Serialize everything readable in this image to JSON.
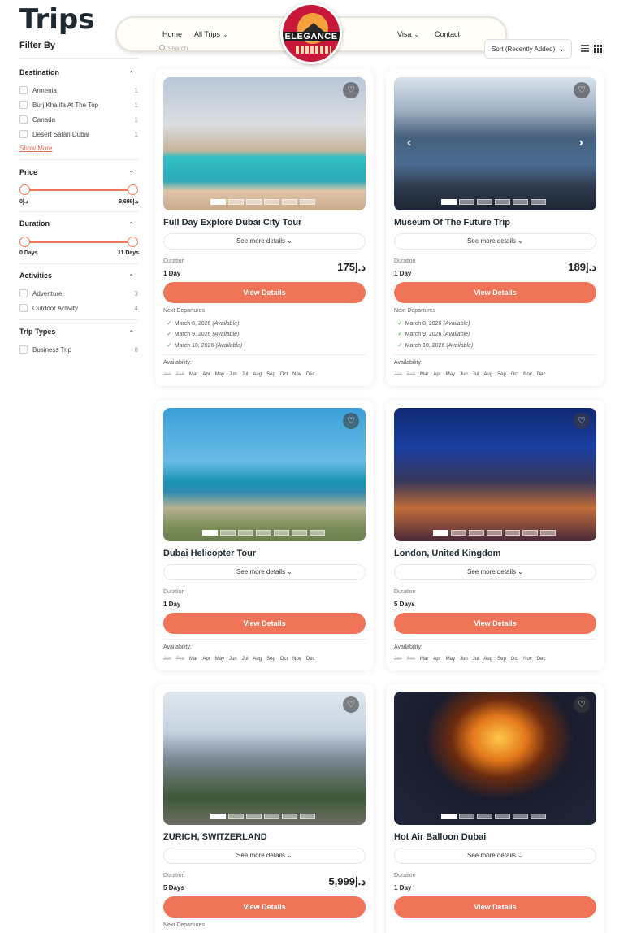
{
  "page": {
    "title": "Trips"
  },
  "nav": {
    "home": "Home",
    "all_trips": "All Trips",
    "visa": "Visa",
    "contact": "Contact",
    "logo_text": "ELEGANCE"
  },
  "search": {
    "placeholder": "Search"
  },
  "sort": {
    "label": "Sort (Recently Added)"
  },
  "sidebar": {
    "filter_by": "Filter By",
    "destination": {
      "title": "Destination",
      "options": [
        {
          "label": "Armenia",
          "count": "1"
        },
        {
          "label": "Burj Khalifa At The Top",
          "count": "1"
        },
        {
          "label": "Canada",
          "count": "1"
        },
        {
          "label": "Desert Safari Dubai",
          "count": "1"
        }
      ],
      "show_more": "Show More"
    },
    "price": {
      "title": "Price",
      "min": "0د.إ",
      "max": "9,699د.إ"
    },
    "duration": {
      "title": "Duration",
      "min": "0 Days",
      "max": "11 Days"
    },
    "activities": {
      "title": "Activities",
      "options": [
        {
          "label": "Adventure",
          "count": "3"
        },
        {
          "label": "Outdoor Activity",
          "count": "4"
        }
      ]
    },
    "trip_types": {
      "title": "Trip Types",
      "options": [
        {
          "label": "Business Trip",
          "count": "8"
        }
      ]
    }
  },
  "common": {
    "see_more": "See more details",
    "duration_label": "Duration",
    "view_details": "View Details",
    "next_departures": "Next Departures",
    "availability": "Availability:",
    "months": [
      "Jan",
      "Feb",
      "Mar",
      "Apr",
      "May",
      "Jun",
      "Jul",
      "Aug",
      "Sep",
      "Oct",
      "Nov",
      "Dec"
    ],
    "available": "(Available)"
  },
  "cards": [
    {
      "title": "Full Day Explore Dubai City Tour",
      "duration": "1 Day",
      "price": "175د.إ",
      "departures": [
        "March 8, 2026",
        "March 9, 2026",
        "March 10, 2026"
      ]
    },
    {
      "title": "Museum Of The Future Trip",
      "duration": "1 Day",
      "price": "189د.إ",
      "departures": [
        "March 8, 2026",
        "March 9, 2026",
        "March 10, 2026"
      ]
    },
    {
      "title": "Dubai Helicopter Tour",
      "duration": "1 Day",
      "price": ""
    },
    {
      "title": "London, United Kingdom",
      "duration": "5 Days",
      "price": ""
    },
    {
      "title": "ZURICH, SWITZERLAND",
      "duration": "5 Days",
      "price": "5,999د.إ"
    },
    {
      "title": "Hot Air Balloon Dubai",
      "duration": "1 Day",
      "price": ""
    }
  ]
}
